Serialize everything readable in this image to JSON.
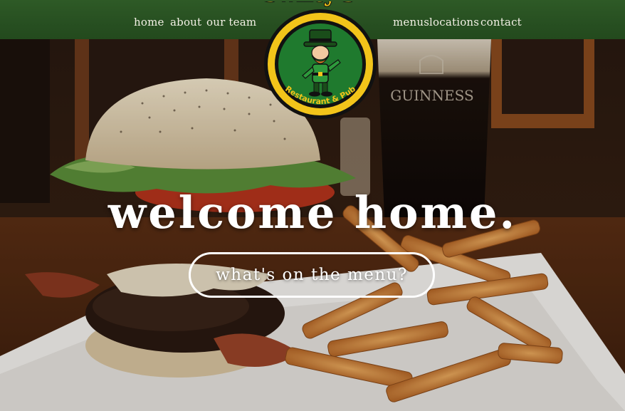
{
  "nav": {
    "left_links": [
      "home",
      "about",
      "our team"
    ],
    "right_links": [
      "menus",
      "locations",
      "contact"
    ]
  },
  "logo": {
    "name": "Swifty's",
    "tagline": "Restaurant & Pub",
    "icon": "leprechaun-icon"
  },
  "hero": {
    "headline": "welcome home.",
    "cta_label": "what's on the menu?",
    "glass_text": "GUINNESS"
  },
  "colors": {
    "nav_green": "#2a5523",
    "logo_yellow": "#f2c41a",
    "logo_green": "#1f7a2e",
    "text_white": "#ffffff"
  }
}
